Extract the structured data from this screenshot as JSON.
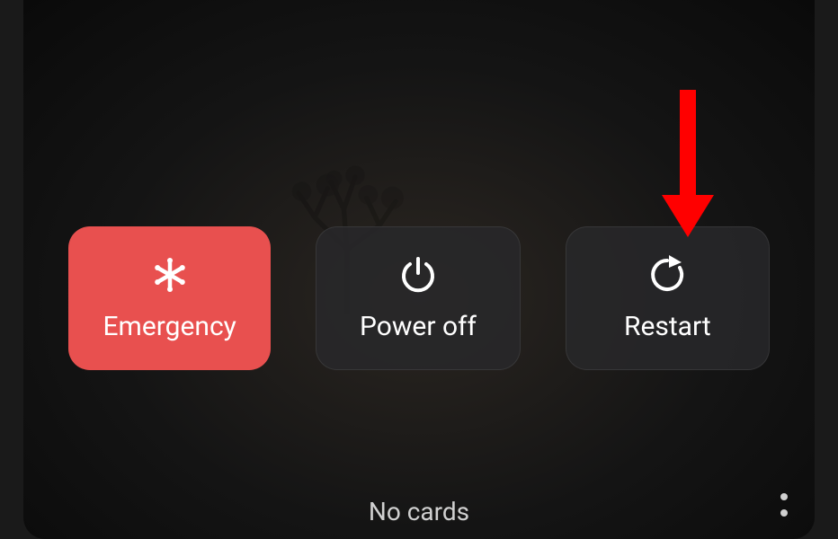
{
  "power_menu": {
    "emergency_label": "Emergency",
    "power_off_label": "Power off",
    "restart_label": "Restart"
  },
  "footer": {
    "no_cards_label": "No cards"
  },
  "colors": {
    "emergency_bg": "#e8504f",
    "button_bg": "#28282a",
    "arrow": "#ff0000"
  },
  "annotation": {
    "arrow_points_to": "restart-button"
  }
}
